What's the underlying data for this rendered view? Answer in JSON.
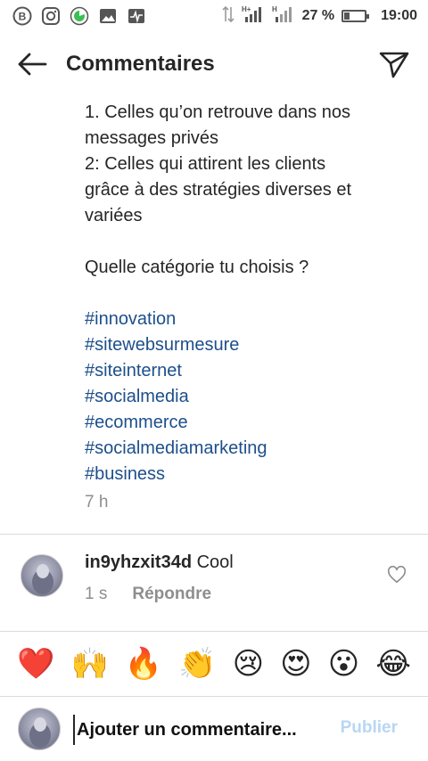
{
  "status_bar": {
    "battery_text": "27 %",
    "battery_level": 0.27,
    "time": "19:00",
    "net_label_1": "H+",
    "net_label_2": "H"
  },
  "header": {
    "title": "Commentaires"
  },
  "post": {
    "caption_lines": [
      "1. Celles qu’on retrouve dans nos",
      "messages privés",
      "2: Celles qui attirent les clients",
      "grâce à des stratégies diverses et",
      "variées",
      "",
      "Quelle catégorie tu choisis ?",
      ""
    ],
    "hashtags": [
      "#innovation",
      "#sitewebsurmesure",
      "#siteinternet",
      "#socialmedia",
      "#ecommerce",
      "#socialmediamarketing",
      "#business"
    ],
    "time": "7 h"
  },
  "comment": {
    "username": "in9yhzxit34d",
    "text": "Cool",
    "time": "1 s",
    "reply_label": "Répondre"
  },
  "emojis": [
    "❤️",
    "🙌",
    "🔥",
    "👏",
    "😢",
    "😍",
    "😮",
    "😂"
  ],
  "composer": {
    "placeholder": "Ajouter un commentaire...",
    "publish_label": "Publier"
  },
  "colors": {
    "hashtag": "#1d4f8b",
    "publish_disabled": "#b8d6f5",
    "secondary_text": "#8e8e8e"
  }
}
